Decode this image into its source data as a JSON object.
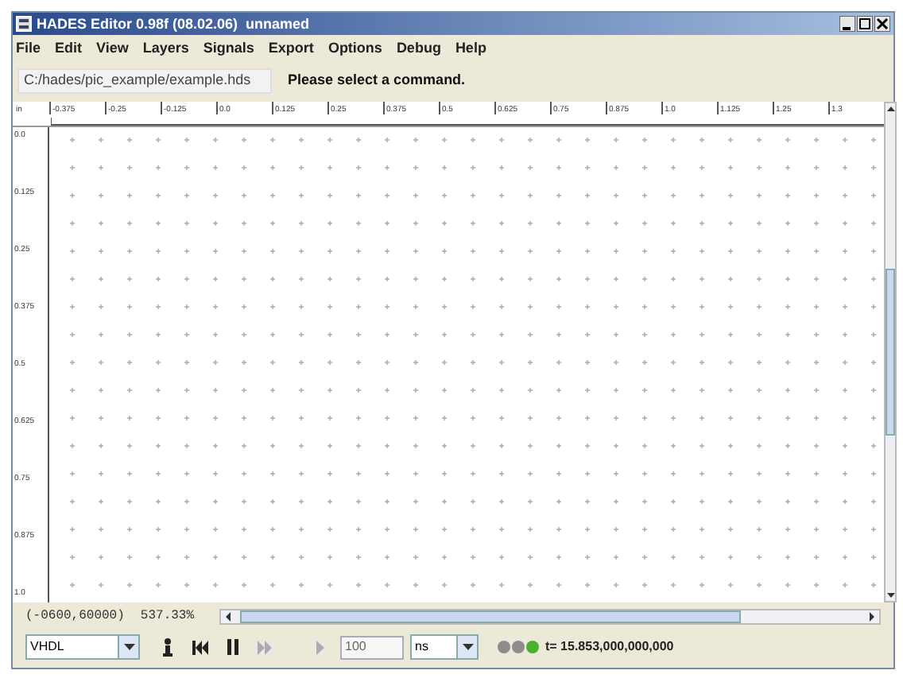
{
  "window": {
    "title": "HADES Editor 0.98f (08.02.06)  unnamed"
  },
  "menu": [
    "File",
    "Edit",
    "View",
    "Layers",
    "Signals",
    "Export",
    "Options",
    "Debug",
    "Help"
  ],
  "path_field": {
    "value": "C:/hades/pic_example/example.hds"
  },
  "status_message": "Please select a command.",
  "ruler_unit": "in",
  "top_ruler": [
    "-0.375",
    "-0.25",
    "-0.125",
    "0.0",
    "0.125",
    "0.25",
    "0.375",
    "0.5",
    "0.625",
    "0.75",
    "0.875",
    "1.0",
    "1.125",
    "1.25",
    "1.3"
  ],
  "left_ruler": [
    "0.0",
    "0.125",
    "0.25",
    "0.375",
    "0.5",
    "0.625",
    "0.75",
    "0.875",
    "1.0"
  ],
  "coordinates": "(-0600,60000)",
  "zoom": "537.33%",
  "language": "VHDL",
  "step_value": "100",
  "time_unit": "ns",
  "indicators": [
    {
      "color": "#8c8c8c"
    },
    {
      "color": "#8c8c8c"
    },
    {
      "color": "#4caf32"
    }
  ],
  "sim_time": "t= 15.853,000,000,000"
}
